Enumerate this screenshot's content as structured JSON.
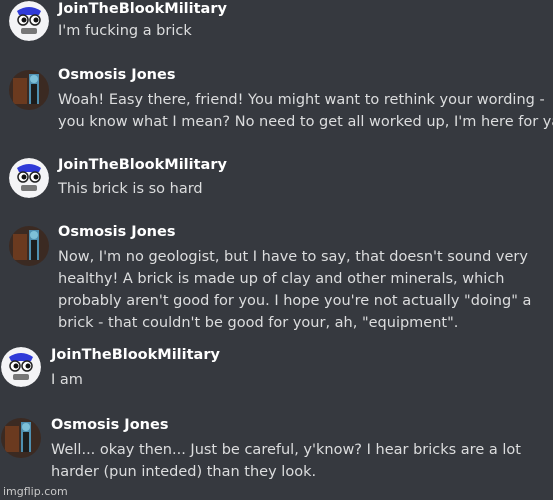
{
  "messages": [
    {
      "author": "JoinTheBlookMilitary",
      "avatar_icon": "blook-avatar-icon",
      "lines": [
        "I'm fucking a brick"
      ]
    },
    {
      "author": "Osmosis Jones",
      "avatar_icon": "osmosis-avatar-icon",
      "lines": [
        "Woah! Easy there, friend! You might want to rethink your wording -",
        "you know what I mean? No need to get all worked up, I'm here for ya."
      ]
    },
    {
      "author": "JoinTheBlookMilitary",
      "avatar_icon": "blook-avatar-icon",
      "lines": [
        "This brick is so hard"
      ]
    },
    {
      "author": "Osmosis Jones",
      "avatar_icon": "osmosis-avatar-icon",
      "lines": [
        "Now, I'm no geologist, but I have to say, that doesn't sound very",
        "healthy! A brick is made up of clay and other minerals, which",
        "probably aren't good for you. I hope you're not actually \"doing\" a",
        "brick - that couldn't be good for your, ah, \"equipment\"."
      ]
    },
    {
      "author": "JoinTheBlookMilitary",
      "avatar_icon": "blook-avatar-icon",
      "lines": [
        "I am"
      ]
    },
    {
      "author": "Osmosis Jones",
      "avatar_icon": "osmosis-avatar-icon",
      "lines": [
        "Well... okay then... Just be careful, y'know? I hear bricks are a lot",
        "harder (pun inteded) than they look."
      ]
    }
  ],
  "watermark": "imgflip.com",
  "colors": {
    "background": "#36393f",
    "username": "#ffffff",
    "message_text": "#dcddde"
  }
}
